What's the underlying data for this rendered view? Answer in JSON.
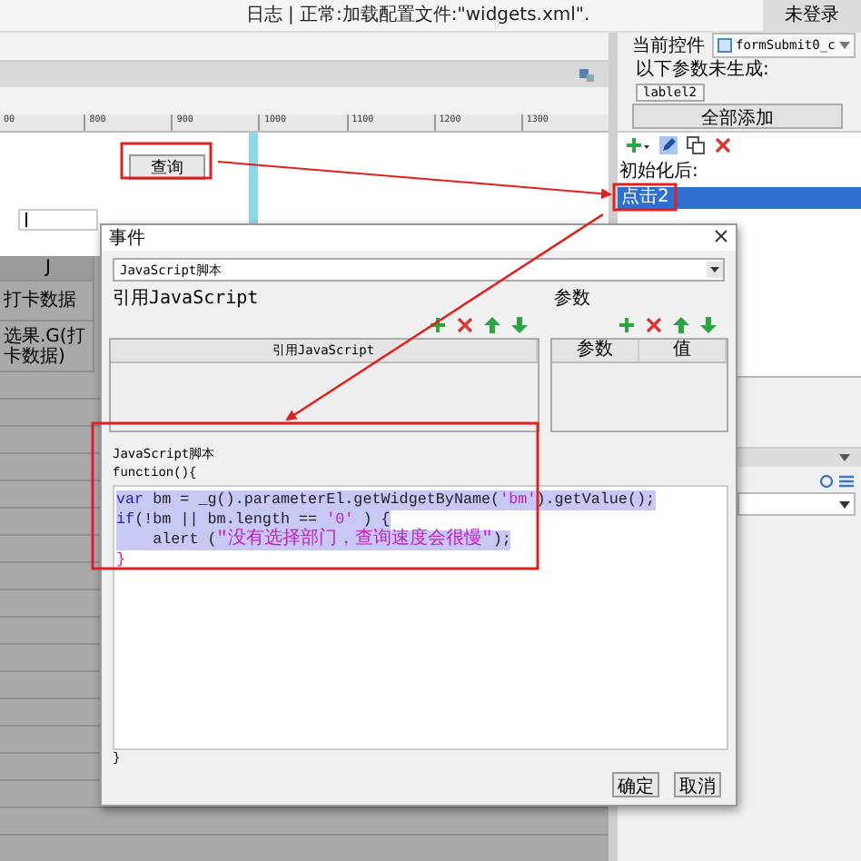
{
  "status_bar": {
    "log": "日志 | 正常:加载配置文件:\"widgets.xml\".",
    "login": "未登录"
  },
  "ruler": {
    "ticks": [
      "00",
      "800",
      "900",
      "1000",
      "1100",
      "1200",
      "1300"
    ]
  },
  "canvas": {
    "button": "查询"
  },
  "sheet": {
    "rows": [
      "J",
      "打卡数据",
      "选果.G(打卡数据)"
    ]
  },
  "properties": {
    "current_control_label": "当前控件",
    "current_control": "formSubmit0_c",
    "missing_params_label": "以下参数未生成:",
    "missing_params": [
      "lablel2"
    ],
    "add_all_button": "全部添加",
    "events": [
      {
        "label": "初始化后:",
        "kind": "group",
        "selected": false
      },
      {
        "label": "点击2",
        "kind": "event",
        "selected": true
      }
    ]
  },
  "dialog": {
    "title": "事件",
    "type": "JavaScript脚本",
    "refs_group": "引用JavaScript",
    "params_group": "参数",
    "refs_columns": [
      "引用JavaScript"
    ],
    "params_columns": [
      "参数",
      "值"
    ],
    "script_group": "JavaScript脚本",
    "header": "function(){",
    "code": [
      {
        "selected": true,
        "tokens": [
          {
            "kind": "keyword",
            "text": "var"
          },
          {
            "kind": "plain",
            "text": " bm = _g().parameterEl.getWidgetByName("
          },
          {
            "kind": "string",
            "text": "'bm'"
          },
          {
            "kind": "plain",
            "text": ").getValue();"
          }
        ]
      },
      {
        "selected": true,
        "tokens": [
          {
            "kind": "keyword",
            "text": "if"
          },
          {
            "kind": "plain",
            "text": "(!bm || bm.length == "
          },
          {
            "kind": "string",
            "text": "'0'"
          },
          {
            "kind": "plain",
            "text": " ) {"
          }
        ]
      },
      {
        "selected": true,
        "tokens": [
          {
            "kind": "plain",
            "text": "    alert ("
          },
          {
            "kind": "string",
            "text": "\"没有选择部门，查询速度会很慢\""
          },
          {
            "kind": "plain",
            "text": ");"
          }
        ]
      },
      {
        "selected": false,
        "tokens": [
          {
            "kind": "string",
            "text": "}"
          }
        ]
      }
    ],
    "footer": "}",
    "buttons": [
      "确定",
      "取消"
    ]
  }
}
